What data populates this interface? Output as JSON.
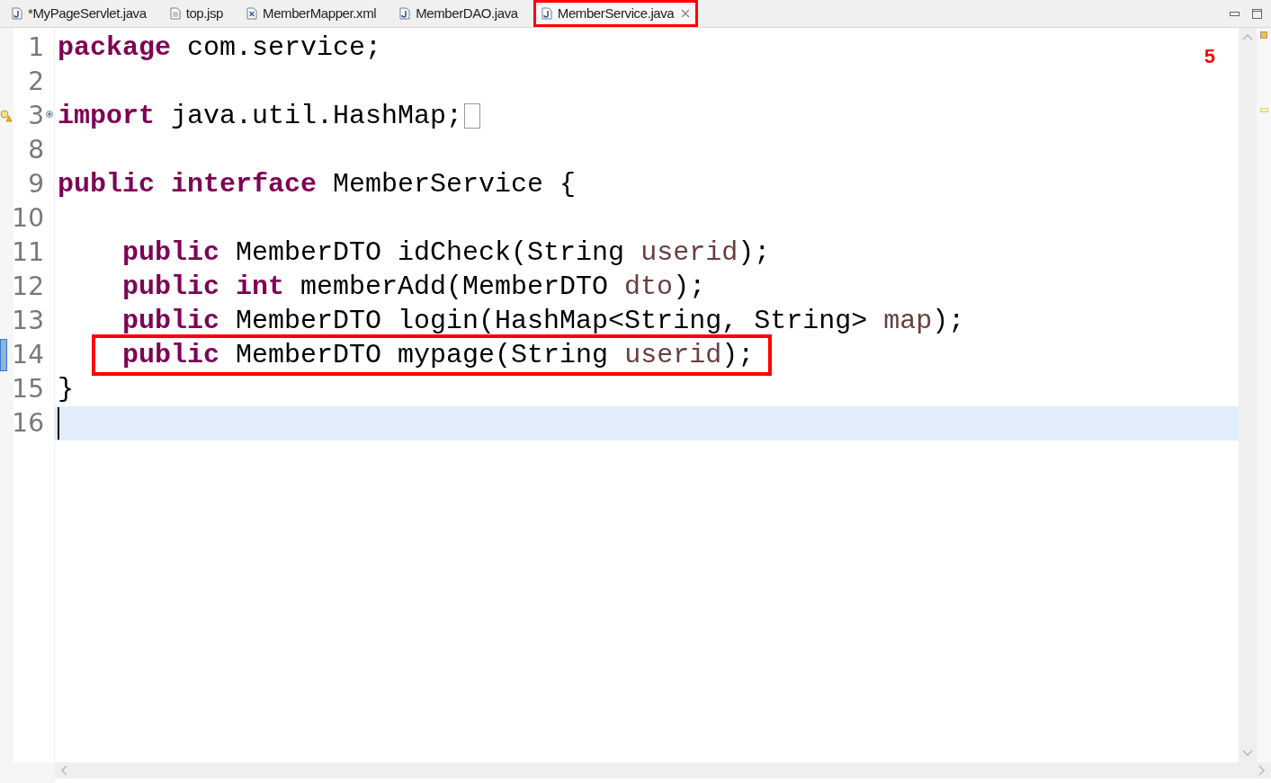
{
  "tabs": [
    {
      "label": "*MyPageServlet.java",
      "kind": "java",
      "selected": false
    },
    {
      "label": "top.jsp",
      "kind": "jsp",
      "selected": false
    },
    {
      "label": "MemberMapper.xml",
      "kind": "xml",
      "selected": false
    },
    {
      "label": "MemberDAO.java",
      "kind": "java",
      "selected": false
    },
    {
      "label": "MemberService.java",
      "kind": "java",
      "selected": true
    }
  ],
  "annotation": "5",
  "lines": [
    {
      "number": "1",
      "tokens": [
        {
          "kind": "keyword",
          "text": "package "
        },
        {
          "kind": "plain",
          "text": "com.service;"
        }
      ],
      "current": false,
      "boxed": false,
      "changed": false,
      "folded": false,
      "warning": false
    },
    {
      "number": "2",
      "current": false,
      "boxed": false,
      "changed": false,
      "folded": false,
      "warning": false
    },
    {
      "number": "3",
      "tokens": [
        {
          "kind": "keyword",
          "text": "import "
        },
        {
          "kind": "plain",
          "text": "java.util.HashMap;"
        }
      ],
      "current": false,
      "boxed": false,
      "changed": false,
      "folded": true,
      "warning": true
    },
    {
      "number": "8",
      "current": false,
      "boxed": false,
      "changed": false,
      "folded": false,
      "warning": false
    },
    {
      "number": "9",
      "tokens": [
        {
          "kind": "keyword",
          "text": "public interface "
        },
        {
          "kind": "plain",
          "text": "MemberService {"
        }
      ],
      "current": false,
      "boxed": false,
      "changed": false,
      "folded": false,
      "warning": false
    },
    {
      "number": "10",
      "current": false,
      "boxed": false,
      "changed": false,
      "folded": false,
      "warning": false
    },
    {
      "number": "11",
      "tokens": [
        {
          "kind": "keyword",
          "text": "    public "
        },
        {
          "kind": "plain",
          "text": "MemberDTO idCheck(String "
        },
        {
          "kind": "param",
          "text": "userid"
        },
        {
          "kind": "plain",
          "text": ");"
        }
      ],
      "current": false,
      "boxed": false,
      "changed": false,
      "folded": false,
      "warning": false
    },
    {
      "number": "12",
      "tokens": [
        {
          "kind": "keyword",
          "text": "    public int "
        },
        {
          "kind": "plain",
          "text": "memberAdd(MemberDTO "
        },
        {
          "kind": "param",
          "text": "dto"
        },
        {
          "kind": "plain",
          "text": ");"
        }
      ],
      "current": false,
      "boxed": false,
      "changed": false,
      "folded": false,
      "warning": false
    },
    {
      "number": "13",
      "tokens": [
        {
          "kind": "keyword",
          "text": "    public "
        },
        {
          "kind": "plain",
          "text": "MemberDTO login(HashMap<String, String> "
        },
        {
          "kind": "param",
          "text": "map"
        },
        {
          "kind": "plain",
          "text": ");"
        }
      ],
      "current": false,
      "boxed": false,
      "changed": false,
      "folded": false,
      "warning": false
    },
    {
      "number": "14",
      "tokens": [
        {
          "kind": "keyword",
          "text": "    public "
        },
        {
          "kind": "plain",
          "text": "MemberDTO mypage(String "
        },
        {
          "kind": "param",
          "text": "userid"
        },
        {
          "kind": "plain",
          "text": ");"
        }
      ],
      "current": false,
      "boxed": true,
      "changed": true,
      "folded": false,
      "warning": false
    },
    {
      "number": "15",
      "tokens": [
        {
          "kind": "plain",
          "text": "}"
        }
      ],
      "current": false,
      "boxed": false,
      "changed": false,
      "folded": false,
      "warning": false
    },
    {
      "number": "16",
      "current": true,
      "boxed": false,
      "changed": false,
      "folded": false,
      "warning": false
    }
  ]
}
